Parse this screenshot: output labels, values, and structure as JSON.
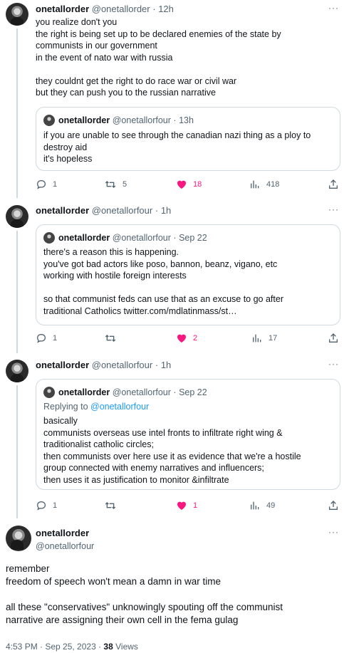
{
  "tweets": [
    {
      "name": "onetallorder",
      "handle": "@onetallorder",
      "sep": "·",
      "time": "12h",
      "text": "you realize don't you\nthe right is being set up to be declared enemies of the state by\ncommunists in our government\nin the event of nato war with russia\n\nthey couldnt get the right to do race war or civil war\nbut they can push you to the russian narrative",
      "quote": {
        "name": "onetallorder",
        "handle": "@onetallorfour",
        "sep": "·",
        "time": "13h",
        "text": "if you are unable to see through the canadian nazi thing as a ploy to\ndestroy aid\nit's hopeless"
      },
      "actions": {
        "replies": "1",
        "retweets": "5",
        "likes": "18",
        "views": "418"
      }
    },
    {
      "name": "onetallorder",
      "handle": "@onetallorfour",
      "sep": "·",
      "time": "1h",
      "quote": {
        "name": "onetallorder",
        "handle": "@onetallorfour",
        "sep": "·",
        "time": "Sep 22",
        "text": "there's a reason this is happening.\nyou've got bad actors like poso, bannon, beanz, vigano, etc\nworking with hostile foreign interests\n\nso that communist feds can use that as an excuse to go after\ntraditional Catholics twitter.com/mdlatinmass/st…"
      },
      "actions": {
        "replies": "1",
        "retweets": "",
        "likes": "2",
        "views": "17"
      }
    },
    {
      "name": "onetallorder",
      "handle": "@onetallorfour",
      "sep": "·",
      "time": "1h",
      "quote": {
        "name": "onetallorder",
        "handle": "@onetallorfour",
        "sep": "·",
        "time": "Sep 22",
        "replying_prefix": "Replying to ",
        "replying_handle": "@onetallorfour",
        "text": "basically\ncommunists overseas use intel fronts to infiltrate right wing &\ntraditionalist catholic circles;\nthen communists over here use it as evidence that we're a hostile\ngroup connected with enemy narratives and influencers;\nthen uses it as justification to monitor &infiltrate"
      },
      "actions": {
        "replies": "1",
        "retweets": "",
        "likes": "1",
        "views": "49"
      }
    }
  ],
  "main": {
    "name": "onetallorder",
    "handle": "@onetallorfour",
    "text": "remember\nfreedom of speech won't mean a damn in war time\n\nall these \"conservatives\" unknowingly spouting off the communist\nnarrative are assigning their own cell in the fema gulag",
    "time": "4:53 PM · Sep 25, 2023 · ",
    "views_count": "38",
    "views_label": " Views"
  },
  "more_icon": "···",
  "colors": {
    "like": "#f91880",
    "muted": "#536471",
    "border": "#cfd9de",
    "link": "#1d9bf0"
  }
}
